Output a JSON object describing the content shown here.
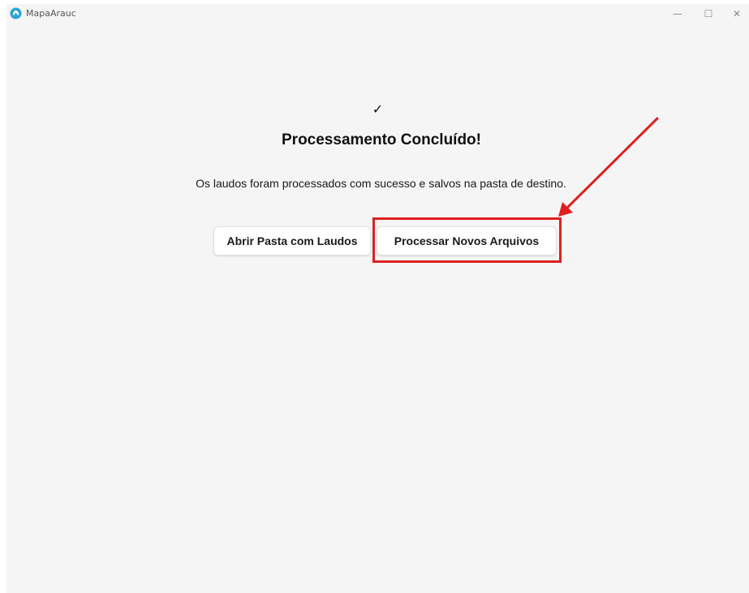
{
  "window": {
    "title": "MapaArauc",
    "controls": {
      "minimize": "—",
      "maximize": "☐",
      "close": "✕"
    }
  },
  "main": {
    "check_symbol": "✓",
    "heading": "Processamento Concluído!",
    "message": "Os laudos foram processados com sucesso e salvos na pasta de destino.",
    "buttons": {
      "open_folder": "Abrir Pasta com Laudos",
      "process_new": "Processar Novos Arquivos"
    }
  },
  "annotation": {
    "color": "#e02020"
  },
  "colors": {
    "background": "#f5f5f5",
    "app_icon": "#2ba4d8"
  }
}
